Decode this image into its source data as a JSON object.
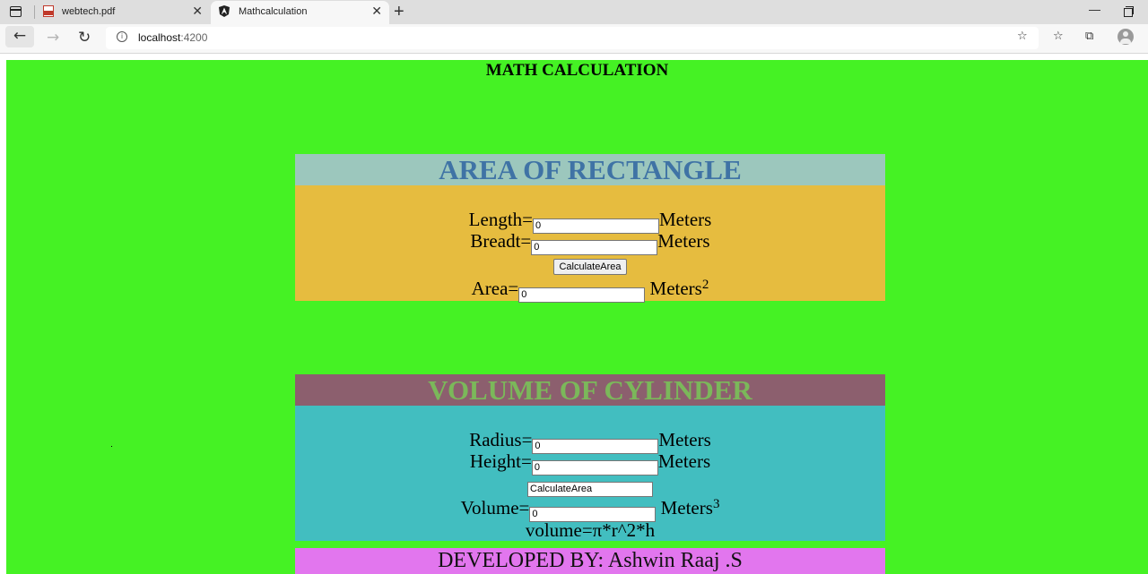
{
  "browser": {
    "tabs": [
      {
        "title": "webtech.pdf",
        "icon": "pdf-icon",
        "active": false
      },
      {
        "title": "Mathcalculation",
        "icon": "angular-icon",
        "active": true
      }
    ],
    "close_glyph": "✕",
    "newtab_glyph": "+",
    "url_host": "localhost",
    "url_port": ":4200"
  },
  "page": {
    "title": "MATH CALCULATION",
    "rectangle": {
      "heading": "AREA OF RECTANGLE",
      "length_label": "Length=",
      "length_value": "0",
      "length_unit": "Meters",
      "breadth_label": "Breadt=",
      "breadth_value": "0",
      "breadth_unit": "Meters",
      "button_label": "CalculateArea",
      "area_label": "Area=",
      "area_value": "0",
      "area_unit": "Meters",
      "area_exp": "2"
    },
    "cylinder": {
      "heading": "VOLUME OF CYLINDER",
      "radius_label": "Radius=",
      "radius_value": "0",
      "radius_unit": "Meters",
      "height_label": "Height=",
      "height_value": "0",
      "height_unit": "Meters",
      "button_label": "CalculateArea",
      "volume_label": "Volume=",
      "volume_value": "0",
      "volume_unit": "Meters",
      "volume_exp": "3",
      "formula": "volume=π*r^2*h"
    },
    "footer": "DEVELOPED BY: Ashwin Raaj .S"
  },
  "colors": {
    "page_background": "#45f224",
    "rect_header": "#9cc7bd",
    "rect_body": "#e6bc3f",
    "cyl_header": "#8c5f6e",
    "cyl_body": "#42bec0",
    "footer": "#e276ee"
  }
}
